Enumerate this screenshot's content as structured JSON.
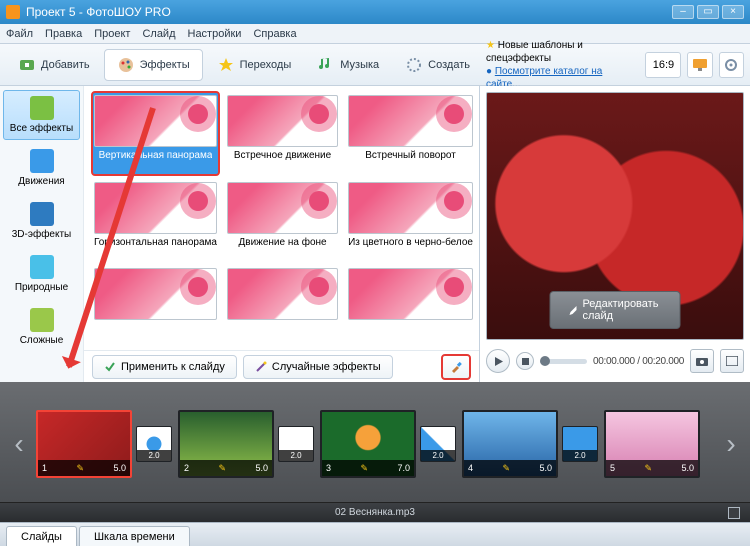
{
  "window": {
    "title": "Проект 5 - ФотоШОУ PRO"
  },
  "menu": {
    "file": "Файл",
    "edit": "Правка",
    "project": "Проект",
    "slide": "Слайд",
    "settings": "Настройки",
    "help": "Справка"
  },
  "tabs": {
    "add": "Добавить",
    "effects": "Эффекты",
    "transitions": "Переходы",
    "music": "Музыка",
    "create": "Создать"
  },
  "promo": {
    "line1": "Новые шаблоны и спецэффекты",
    "line2": "Посмотрите каталог на сайте..."
  },
  "ratio": "16:9",
  "sidebar": [
    {
      "key": "all",
      "label": "Все эффекты"
    },
    {
      "key": "motion",
      "label": "Движения"
    },
    {
      "key": "3d",
      "label": "3D-эффекты"
    },
    {
      "key": "nature",
      "label": "Природные"
    },
    {
      "key": "complex",
      "label": "Сложные"
    }
  ],
  "effects": [
    {
      "label": "Вертикальная панорама",
      "selected": true
    },
    {
      "label": "Встречное движение"
    },
    {
      "label": "Встречный поворот"
    },
    {
      "label": "Горизонтальная панорама"
    },
    {
      "label": "Движение на фоне"
    },
    {
      "label": "Из цветного в черно-белое"
    },
    {
      "label": ""
    },
    {
      "label": ""
    },
    {
      "label": ""
    }
  ],
  "fxButtons": {
    "apply": "Применить к слайду",
    "random": "Случайные эффекты"
  },
  "preview": {
    "edit": "Редактировать слайд"
  },
  "timecode": {
    "current": "00:00.000",
    "total": "00:20.000",
    "sep": " / "
  },
  "slides": [
    {
      "idx": "1",
      "dur": "5.0",
      "sel": true,
      "bg": "linear-gradient(135deg,#c62828,#8e1b1b)"
    },
    {
      "idx": "2",
      "dur": "5.0",
      "bg": "linear-gradient(#295f2e,#8fbf4a)"
    },
    {
      "idx": "3",
      "dur": "7.0",
      "bg": "radial-gradient(circle at 50% 40%,#f6a13a 0 20%,#1b6b2b 22%)"
    },
    {
      "idx": "4",
      "dur": "5.0",
      "bg": "linear-gradient(#6fb5e9,#2764a6)"
    },
    {
      "idx": "5",
      "dur": "5.0",
      "bg": "linear-gradient(#f5c6e0,#d77fb1)"
    }
  ],
  "transitions": [
    {
      "val": "2.0",
      "style": "radial-gradient(circle,#3a9ae8 30%,#fff 32%)"
    },
    {
      "val": "2.0",
      "style": "linear-gradient(#fff,#fff)"
    },
    {
      "val": "2.0",
      "style": "linear-gradient(45deg,#3a9ae8 49%,#fff 51%)"
    },
    {
      "val": "2.0",
      "style": "linear-gradient(#3a9ae8,#3a9ae8)"
    }
  ],
  "audio": {
    "track": "02 Веснянка.mp3"
  },
  "bottomTabs": {
    "slides": "Слайды",
    "timeline": "Шкала времени"
  },
  "icons": {
    "add": "#5aa84f",
    "effects": "#e07a2e",
    "transitions": "#f5c518",
    "music": "#3aa357",
    "create": "#7a8fa6",
    "all": "#7bc043",
    "motion": "#3a9ae8",
    "3d": "#2e7bc0",
    "nature": "#49c0e8",
    "complex": "#9ac84a"
  }
}
